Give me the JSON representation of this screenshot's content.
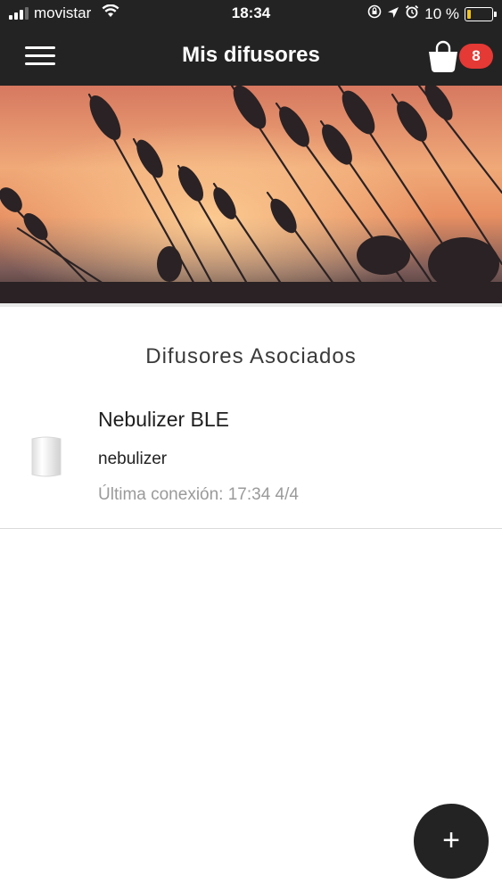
{
  "status_bar": {
    "carrier": "movistar",
    "time": "18:34",
    "battery": "10 %",
    "icons": [
      "signal-icon",
      "wifi-icon",
      "rotation-lock-icon",
      "location-icon",
      "alarm-icon",
      "battery-icon"
    ]
  },
  "header": {
    "title": "Mis difusores",
    "cart_count": "8",
    "background_color": "#242323",
    "badge_color": "#e53935"
  },
  "section": {
    "title": "Difusores Asociados"
  },
  "devices": [
    {
      "name": "Nebulizer BLE",
      "type": "nebulizer",
      "last_connection": "Última conexión: 17:34 4/4"
    }
  ],
  "fab": {
    "label": "+"
  }
}
